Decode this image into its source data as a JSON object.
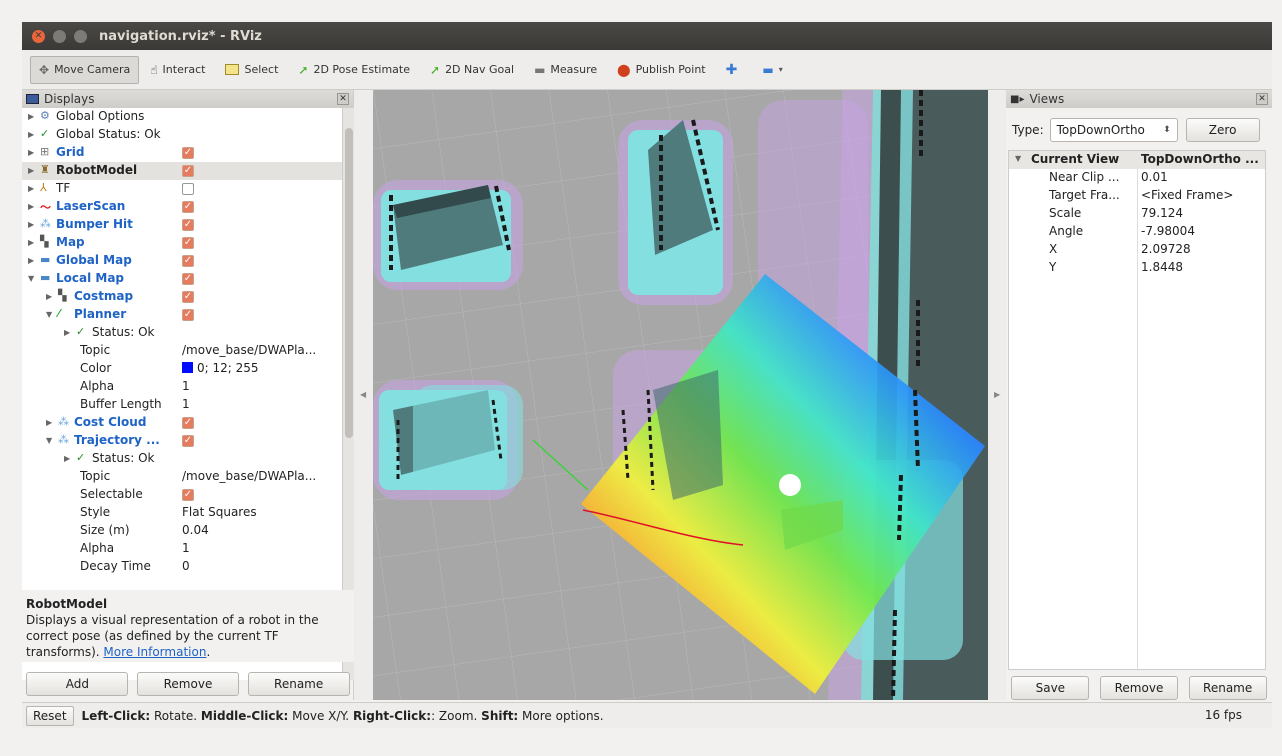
{
  "window": {
    "title": "navigation.rviz* - RViz"
  },
  "toolbar": {
    "tools": [
      {
        "label": "Move Camera",
        "icon": "move-camera-icon",
        "glyph": "✥"
      },
      {
        "label": "Interact",
        "icon": "hand-icon",
        "glyph": "☝"
      },
      {
        "label": "Select",
        "icon": "select-box-icon",
        "glyph": "▭"
      },
      {
        "label": "2D Pose Estimate",
        "icon": "pose-arrow-icon",
        "glyph": "➚"
      },
      {
        "label": "2D Nav Goal",
        "icon": "nav-arrow-icon",
        "glyph": "➚"
      },
      {
        "label": "Measure",
        "icon": "ruler-icon",
        "glyph": "▬"
      },
      {
        "label": "Publish Point",
        "icon": "pin-icon",
        "glyph": "●"
      }
    ]
  },
  "displays": {
    "title": "Displays",
    "items": [
      {
        "label": "Global Options",
        "indent": 0
      },
      {
        "label": "Global Status: Ok",
        "indent": 0
      },
      {
        "label": "Grid",
        "indent": 0
      },
      {
        "label": "RobotModel",
        "indent": 0
      },
      {
        "label": "TF",
        "indent": 0
      },
      {
        "label": "LaserScan",
        "indent": 0
      },
      {
        "label": "Bumper Hit",
        "indent": 0
      },
      {
        "label": "Map",
        "indent": 0
      },
      {
        "label": "Global Map",
        "indent": 0
      },
      {
        "label": "Local Map",
        "indent": 0
      },
      {
        "label": "Costmap",
        "indent": 1
      },
      {
        "label": "Planner",
        "indent": 1
      },
      {
        "label": "Status: Ok",
        "indent": 2
      },
      {
        "label": "Topic",
        "value": "/move_base/DWAPla..."
      },
      {
        "label": "Color",
        "value": "0; 12; 255"
      },
      {
        "label": "Alpha",
        "value": "1"
      },
      {
        "label": "Buffer Length",
        "value": "1"
      },
      {
        "label": "Cost Cloud",
        "indent": 1
      },
      {
        "label": "Trajectory ...",
        "indent": 1
      },
      {
        "label": "Status: Ok",
        "indent": 2
      },
      {
        "label": "Topic",
        "value": "/move_base/DWAPla..."
      },
      {
        "label": "Selectable",
        "value": ""
      },
      {
        "label": "Style",
        "value": "Flat Squares"
      },
      {
        "label": "Size (m)",
        "value": "0.04"
      },
      {
        "label": "Alpha",
        "value": "1"
      },
      {
        "label": "Decay Time",
        "value": "0"
      }
    ],
    "description": {
      "title": "RobotModel",
      "text": "Displays a visual representation of a robot in the correct pose (as defined by the current TF transforms).",
      "link": "More Information"
    },
    "buttons": {
      "add": "Add",
      "remove": "Remove",
      "rename": "Rename"
    }
  },
  "views": {
    "title": "Views",
    "type_label": "Type:",
    "type_value": "TopDownOrtho",
    "zero": "Zero",
    "current_view": {
      "key": "Current View",
      "value": "TopDownOrtho ..."
    },
    "props": [
      {
        "k": "Near Clip ...",
        "v": "0.01"
      },
      {
        "k": "Target Fra...",
        "v": "<Fixed Frame>"
      },
      {
        "k": "Scale",
        "v": "79.124"
      },
      {
        "k": "Angle",
        "v": "-7.98004"
      },
      {
        "k": "X",
        "v": "2.09728"
      },
      {
        "k": "Y",
        "v": "1.8448"
      }
    ],
    "buttons": {
      "save": "Save",
      "remove": "Remove",
      "rename": "Rename"
    }
  },
  "status": {
    "reset": "Reset",
    "hint": {
      "left_key": "Left-Click:",
      "left_text": " Rotate. ",
      "middle_key": "Middle-Click:",
      "middle_text": " Move X/Y. ",
      "right_key": "Right-Click:",
      "right_text": ": Zoom. ",
      "shift_key": "Shift:",
      "shift_text": " More options."
    },
    "fps": "16 fps"
  }
}
